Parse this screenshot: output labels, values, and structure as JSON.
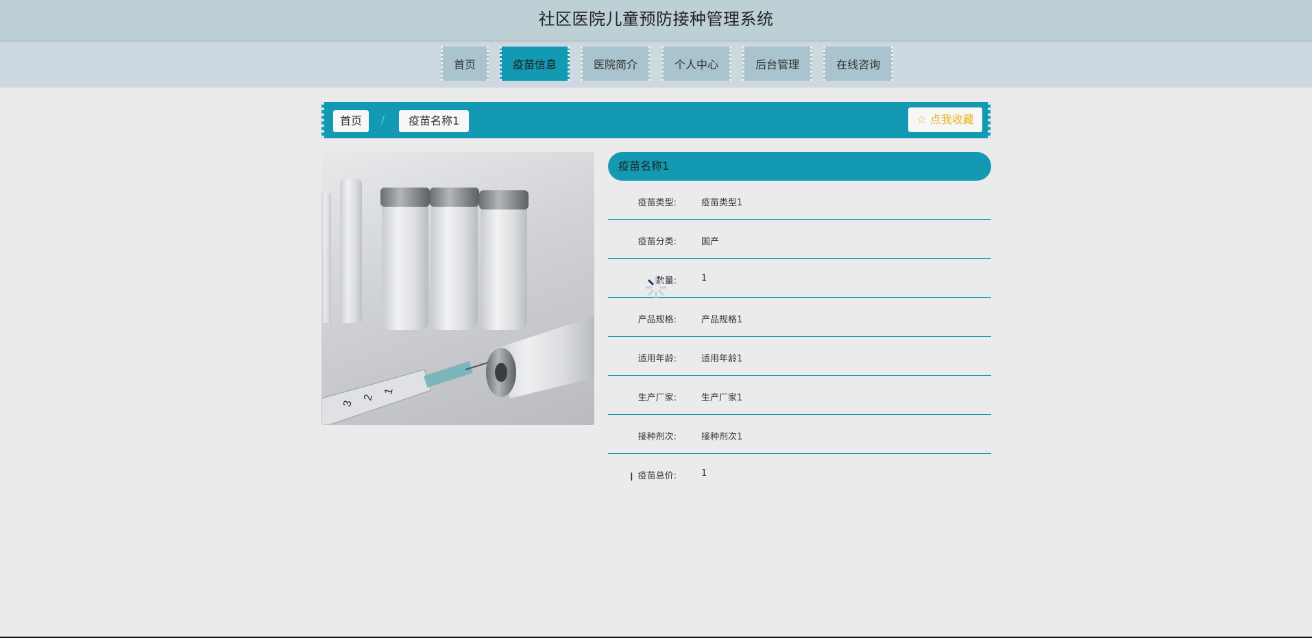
{
  "app": {
    "title": "社区医院儿童预防接种管理系统"
  },
  "nav": {
    "items": [
      {
        "label": "首页"
      },
      {
        "label": "疫苗信息"
      },
      {
        "label": "医院简介"
      },
      {
        "label": "个人中心"
      },
      {
        "label": "后台管理"
      },
      {
        "label": "在线咨询"
      }
    ],
    "active": "疫苗信息"
  },
  "breadcrumb": {
    "home": "首页",
    "separator": "/",
    "current": "疫苗名称1"
  },
  "favorite": {
    "icon": "star-outline-icon",
    "label": "点我收藏"
  },
  "product": {
    "image_alt": "vaccine-vials-and-syringe",
    "name": "疫苗名称1",
    "fields": [
      {
        "label": "疫苗类型:",
        "value": "疫苗类型1"
      },
      {
        "label": "疫苗分类:",
        "value": "国产"
      },
      {
        "label": "数量:",
        "value": "1"
      },
      {
        "label": "产品规格:",
        "value": "产品规格1"
      },
      {
        "label": "适用年龄:",
        "value": "适用年龄1"
      },
      {
        "label": "生产厂家:",
        "value": "生产厂家1"
      },
      {
        "label": "接种剂次:",
        "value": "接种剂次1"
      },
      {
        "label": "疫苗总价:",
        "value": "1"
      }
    ]
  },
  "colors": {
    "accent": "#1499b3",
    "header_bg": "#bdd0d6",
    "nav_bg": "#cdd8e0",
    "nav_item_bg": "#a9c4cc",
    "favorite_text": "#e8b41a",
    "page_bg": "#ebebeb"
  }
}
